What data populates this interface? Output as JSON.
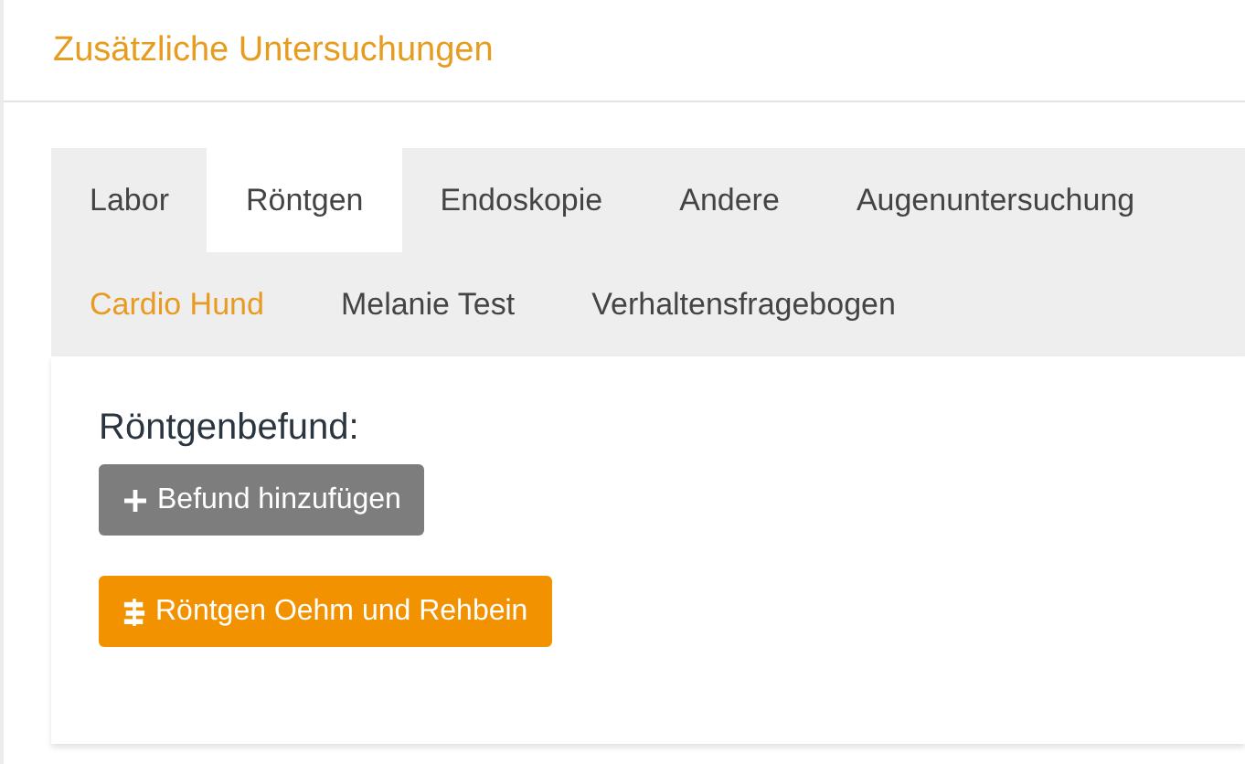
{
  "header": {
    "title": "Zusätzliche Untersuchungen"
  },
  "tab_rows": [
    [
      {
        "label": "Labor",
        "selected": false,
        "accent": false
      },
      {
        "label": "Röntgen",
        "selected": true,
        "accent": false
      },
      {
        "label": "Endoskopie",
        "selected": false,
        "accent": false
      },
      {
        "label": "Andere",
        "selected": false,
        "accent": false
      },
      {
        "label": "Augenuntersuchung",
        "selected": false,
        "accent": false
      }
    ],
    [
      {
        "label": "Cardio Hund",
        "selected": false,
        "accent": true
      },
      {
        "label": "Melanie Test",
        "selected": false,
        "accent": false
      },
      {
        "label": "Verhaltensfragebogen",
        "selected": false,
        "accent": false
      }
    ]
  ],
  "panel": {
    "heading": "Röntgenbefund:",
    "buttons": [
      {
        "kind": "add",
        "label": "Befund hinzufügen"
      },
      {
        "kind": "template",
        "label": "Röntgen Oehm und Rehbein"
      }
    ]
  }
}
